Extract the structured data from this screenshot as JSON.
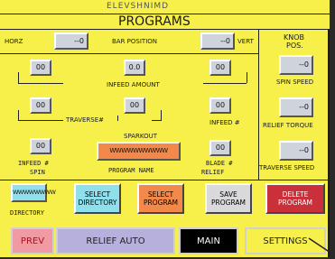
{
  "header": {
    "top_strip": "ELEVSHNIMD",
    "title": "PROGRAMS"
  },
  "top_row": {
    "horiz_label": "HORZ",
    "horiz_value": "--0",
    "bar_position_label": "BAR POSITION",
    "bar_value": "--0",
    "vert_label": "VERT"
  },
  "knob": {
    "title_line1": "KNOB",
    "title_line2": "POS.",
    "spin_speed_value": "--0",
    "spin_speed_label": "SPIN SPEED",
    "relief_torque_value": "--0",
    "relief_torque_label": "RELIEF TORQUE",
    "traverse_speed_value": "--0",
    "traverse_speed_label": "TRAVERSE SPEED"
  },
  "fields": {
    "infeed_left_1": "00",
    "infeed_center": "0.0",
    "infeed_right_1": "00",
    "infeed_amount_label": "INFEED AMOUNT",
    "traverse_left": "00",
    "traverse_center": "00",
    "traverse_right": "00",
    "traverse_label": "TRAVERSE#",
    "infeed_num_label": "INFEED #",
    "sparkout_label": "SPARKOUT",
    "spin_value": "00",
    "spin_label_1": "INFEED #",
    "spin_label_2": "SPIN",
    "program_name_value": "WWWWWWWWWW",
    "program_name_label": "PROGRAM NAME",
    "blade_value": "00",
    "blade_label_1": "BLADE #",
    "blade_label_2": "RELIEF"
  },
  "directory": {
    "value": "WWWWWWWW",
    "label": "DIRECTORY"
  },
  "actions": {
    "select_directory": "SELECT DIRECTORY",
    "select_program": "SELECT PROGRAM",
    "save_program": "SAVE PROGRAM",
    "delete_program": "DELETE PROGRAM"
  },
  "nav": {
    "prev": "PREV",
    "relief_auto": "RELIEF AUTO",
    "main": "MAIN",
    "settings": "SETTINGS"
  },
  "colors": {
    "panel": "#f7f04a",
    "select_directory": "#8fe0ec",
    "select_program": "#f2894a",
    "save_program": "#d9d9dc",
    "delete_program": "#c9303a",
    "prev": "#f09aa4",
    "relief_auto": "#b7b0dc",
    "main": "#000000"
  }
}
